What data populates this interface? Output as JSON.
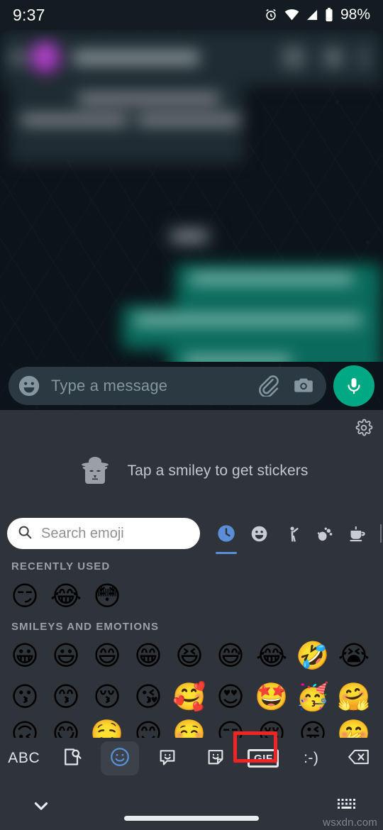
{
  "status_bar": {
    "time": "9:37",
    "battery_percent": "98%",
    "icons": [
      "alarm-icon",
      "wifi-icon",
      "cellular-signal-icon",
      "battery-icon"
    ]
  },
  "chat": {
    "header": {
      "back_icon": "back-arrow-icon",
      "avatar": "contact-avatar",
      "contact_name": "",
      "action_icons": [
        "video-call-icon",
        "voice-call-icon",
        "overflow-menu-icon"
      ]
    },
    "blurred": true,
    "note": "conversation content is blurred for privacy"
  },
  "composer": {
    "placeholder": "Type a message",
    "emoji_icon": "emoji-smiley-icon",
    "attach_icon": "paperclip-icon",
    "camera_icon": "camera-icon",
    "mic_icon": "microphone-icon",
    "mic_color": "#00a884"
  },
  "sticker_suggestion": {
    "text": "Tap a smiley to get stickers",
    "character_icon": "cowboy-sticker-icon",
    "settings_icon": "gear-icon"
  },
  "emoji_panel": {
    "search": {
      "placeholder": "Search emoji",
      "icon": "search-icon"
    },
    "active_tab_color": "#5b8dd9",
    "category_tabs": [
      {
        "name": "recently-used",
        "icon": "clock-icon",
        "active": true
      },
      {
        "name": "smileys-and-emotions",
        "icon": "smiley-icon",
        "active": false
      },
      {
        "name": "people",
        "icon": "person-icon",
        "active": false
      },
      {
        "name": "animals-and-nature",
        "icon": "animals-nature-icon",
        "active": false
      },
      {
        "name": "food-and-drink",
        "icon": "coffee-cup-icon",
        "active": false
      }
    ],
    "sections": [
      {
        "label": "RECENTLY USED",
        "emojis": [
          "😏",
          "😂",
          "😳"
        ]
      },
      {
        "label": "SMILEYS AND EMOTIONS",
        "rows": [
          [
            "😀",
            "😃",
            "😄",
            "😁",
            "😆",
            "😅",
            "😂",
            "🤣",
            "😭"
          ],
          [
            "😗",
            "😙",
            "😚",
            "😘",
            "🥰",
            "😍",
            "🤩",
            "🥳",
            "🤗"
          ],
          [
            "🙃",
            "😋",
            "🤤",
            "😊",
            "☺️",
            "😏",
            "😌",
            "😜",
            "🤭"
          ]
        ]
      }
    ]
  },
  "keyboard_bar": {
    "items": [
      {
        "name": "abc-key",
        "label": "ABC",
        "type": "text"
      },
      {
        "name": "image-search-key",
        "label": "",
        "type": "icon",
        "icon": "image-search-icon"
      },
      {
        "name": "emoji-key",
        "label": "",
        "type": "icon",
        "icon": "emoji-smiley-icon",
        "active": true
      },
      {
        "name": "sticker-bubble-key",
        "label": "",
        "type": "icon",
        "icon": "sticker-bubble-icon"
      },
      {
        "name": "sticker-key",
        "label": "",
        "type": "icon",
        "icon": "sticker-icon"
      },
      {
        "name": "gif-key",
        "label": "GIF",
        "type": "gif",
        "highlighted": true
      },
      {
        "name": "emoticon-key",
        "label": ":-)",
        "type": "text"
      },
      {
        "name": "backspace-key",
        "label": "",
        "type": "icon",
        "icon": "backspace-icon"
      }
    ],
    "highlight_color": "#f02424",
    "active_key_color": "#5b8dd9"
  },
  "nav_bar": {
    "back_icon": "chevron-down-icon",
    "home_indicator": "home-indicator",
    "keyboard_switch_icon": "keyboard-switcher-icon",
    "watermark": "wsxdn.com"
  }
}
